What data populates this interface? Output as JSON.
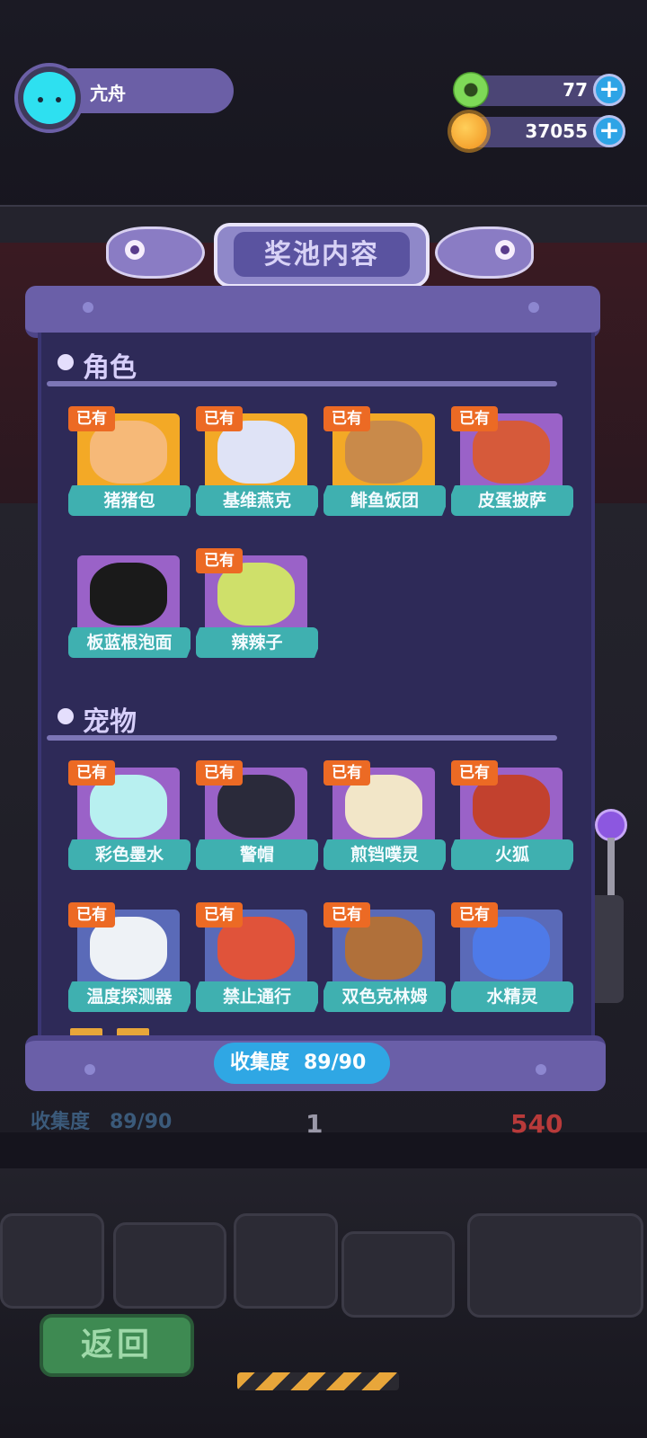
{
  "player": {
    "name": "亢舟"
  },
  "currencies": [
    {
      "name": "green-donut",
      "value": "77",
      "color": "#7ed957"
    },
    {
      "name": "orange-planet",
      "value": "37055",
      "color": "#f5a623"
    }
  ],
  "pool": {
    "title": "奖池内容",
    "owned_badge": "已有",
    "sections": [
      {
        "title": "角色",
        "items": [
          {
            "name": "猪猪包",
            "owned": true,
            "frame": "#f3a926",
            "art": "#f6b978"
          },
          {
            "name": "基维燕克",
            "owned": true,
            "frame": "#f3a926",
            "art": "#dfe3f6"
          },
          {
            "name": "鲱鱼饭团",
            "owned": true,
            "frame": "#f3a926",
            "art": "#c98a4a"
          },
          {
            "name": "皮蛋披萨",
            "owned": true,
            "frame": "#9a62c8",
            "art": "#d65a3a"
          },
          {
            "name": "板蓝根泡面",
            "owned": false,
            "frame": "#9a62c8",
            "art": "#1a1a1a"
          },
          {
            "name": "辣辣子",
            "owned": true,
            "frame": "#9a62c8",
            "art": "#cfe06a"
          }
        ]
      },
      {
        "title": "宠物",
        "items": [
          {
            "name": "彩色墨水",
            "owned": true,
            "frame": "#9a62c8",
            "art": "#b8f0f0"
          },
          {
            "name": "警帽",
            "owned": true,
            "frame": "#9a62c8",
            "art": "#2a2a3a"
          },
          {
            "name": "煎铛噗灵",
            "owned": true,
            "frame": "#9a62c8",
            "art": "#f2e6c8"
          },
          {
            "name": "火狐",
            "owned": true,
            "frame": "#9a62c8",
            "art": "#c2412e"
          },
          {
            "name": "温度探测器",
            "owned": true,
            "frame": "#5a6ab8",
            "art": "#eef2f6"
          },
          {
            "name": "禁止通行",
            "owned": true,
            "frame": "#5a6ab8",
            "art": "#e0533a"
          },
          {
            "name": "双色克林姆",
            "owned": true,
            "frame": "#5a6ab8",
            "art": "#b0703a"
          },
          {
            "name": "水精灵",
            "owned": true,
            "frame": "#5a6ab8",
            "art": "#4e7ae8"
          }
        ]
      }
    ],
    "progress_label": "收集度",
    "progress_value": "89/90"
  },
  "background": {
    "behind_progress": "收集度　89/90",
    "counter_1": "1",
    "counter_2": "540"
  },
  "return_button": "返回"
}
